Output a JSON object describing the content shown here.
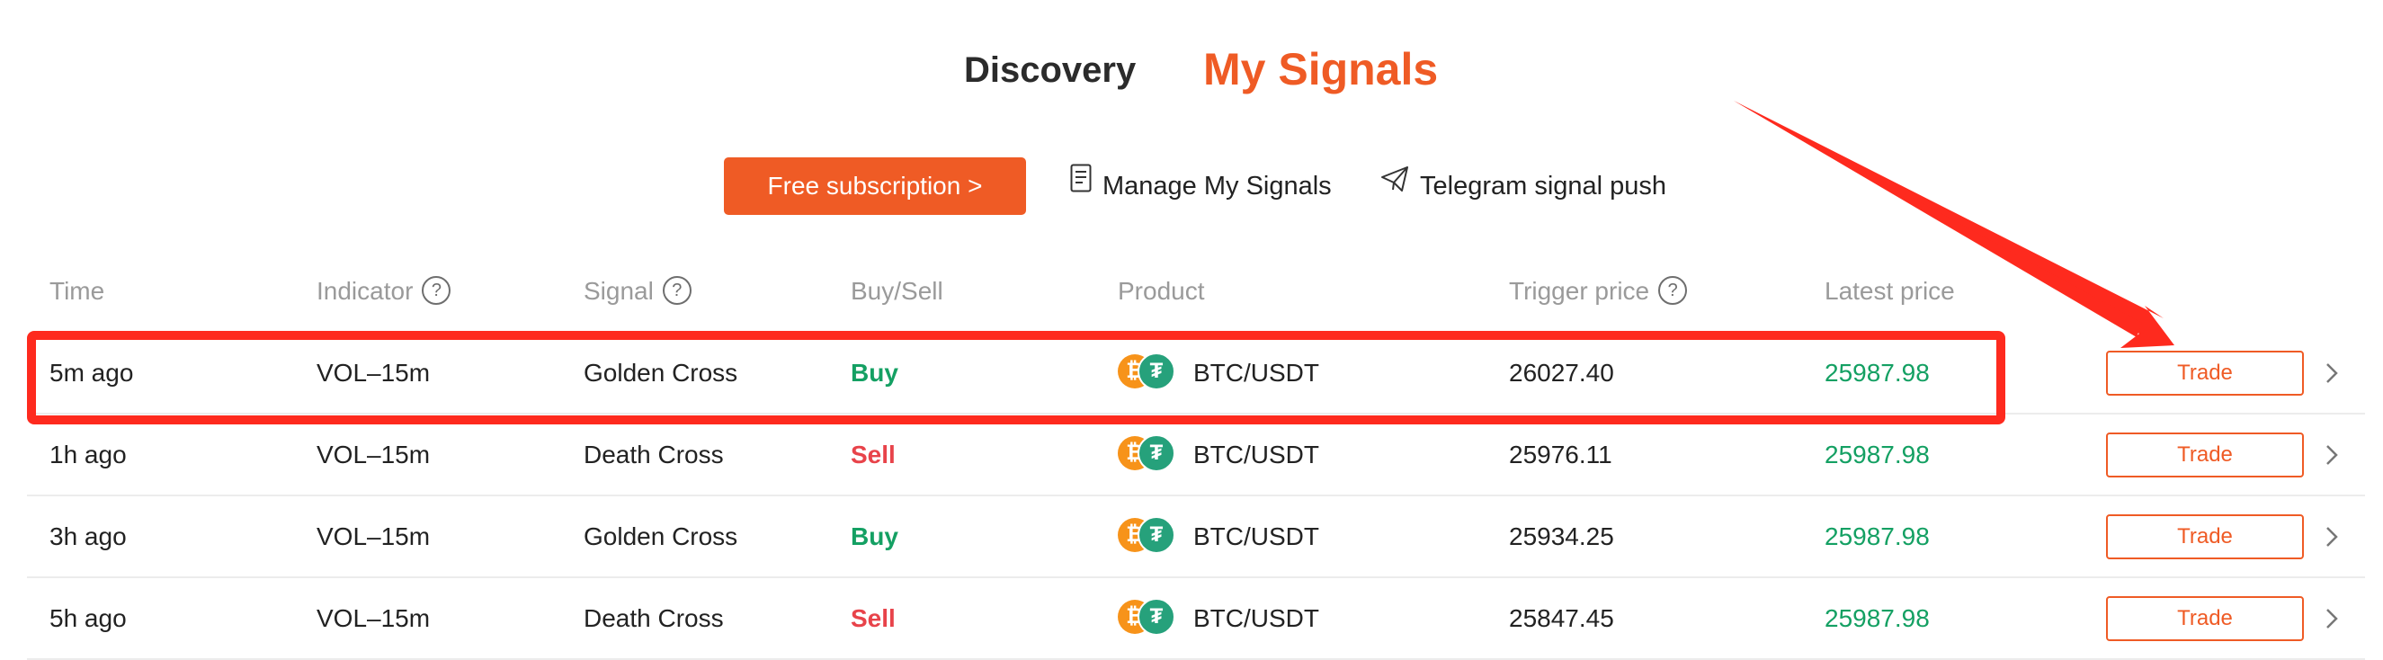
{
  "tabs": {
    "discovery": "Discovery",
    "my_signals": "My Signals"
  },
  "actions": {
    "subscribe": "Free subscription >",
    "manage": "Manage My Signals",
    "telegram": "Telegram signal push"
  },
  "table": {
    "headers": {
      "time": "Time",
      "indicator": "Indicator",
      "signal": "Signal",
      "buysell": "Buy/Sell",
      "product": "Product",
      "trigger": "Trigger price",
      "latest": "Latest price"
    },
    "help_glyph": "?",
    "rows": [
      {
        "time": "5m ago",
        "indicator": "VOL–15m",
        "signal": "Golden Cross",
        "side": "Buy",
        "product": "BTC/USDT",
        "trigger": "26027.40",
        "latest": "25987.98",
        "action": "Trade"
      },
      {
        "time": "1h ago",
        "indicator": "VOL–15m",
        "signal": "Death Cross",
        "side": "Sell",
        "product": "BTC/USDT",
        "trigger": "25976.11",
        "latest": "25987.98",
        "action": "Trade"
      },
      {
        "time": "3h ago",
        "indicator": "VOL–15m",
        "signal": "Golden Cross",
        "side": "Buy",
        "product": "BTC/USDT",
        "trigger": "25934.25",
        "latest": "25987.98",
        "action": "Trade"
      },
      {
        "time": "5h ago",
        "indicator": "VOL–15m",
        "signal": "Death Cross",
        "side": "Sell",
        "product": "BTC/USDT",
        "trigger": "25847.45",
        "latest": "25987.98",
        "action": "Trade"
      }
    ]
  },
  "colors": {
    "accent": "#ef5b25",
    "buy": "#14a063",
    "sell": "#e8434a",
    "annotation": "#fe2a1e"
  },
  "icons": {
    "manage": "document-icon",
    "telegram": "paper-plane-icon",
    "help": "question-circle-icon",
    "row_chevron": "chevron-right-icon",
    "coin_base": "btc-coin-icon",
    "coin_quote": "usdt-coin-icon"
  }
}
